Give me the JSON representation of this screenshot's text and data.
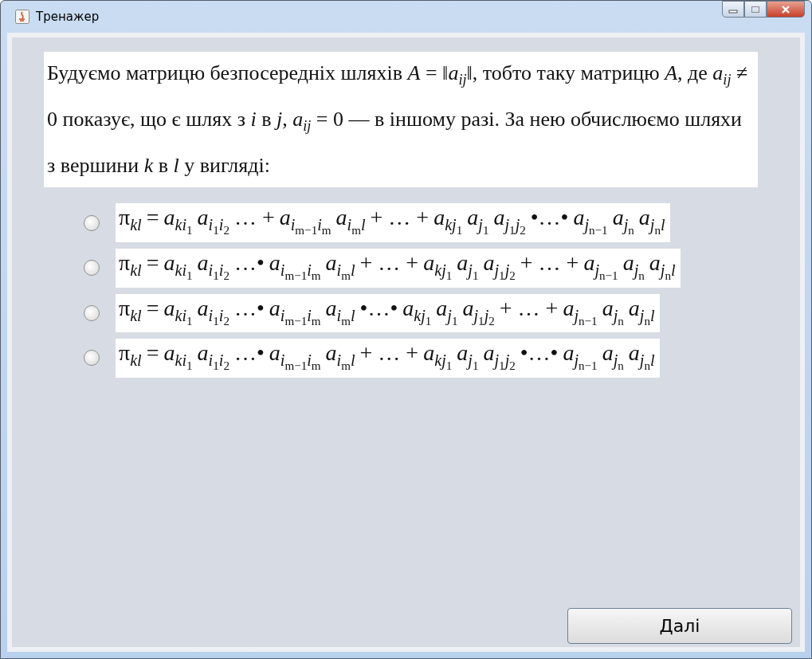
{
  "window": {
    "title": "Тренажер"
  },
  "intro": "Будуємо матрицю безпосередніх шляхів *A* = ‖*a*$_{ij}$‖, тобто таку матрицю *A*, де *a*$_{ij}$ ≠ 0 показує, що є шлях з *i* в *j*, *a*$_{ij}$ = 0 — в іншому разі. За нею обчислюємо шляхи з вершини *k* в *l* у вигляді:",
  "options": [
    {
      "selected": false,
      "formula": [
        {
          "kind": "pi",
          "base": "π",
          "sub": [
            [
              "kl"
            ]
          ]
        },
        {
          "kind": "op",
          "text": "="
        },
        {
          "kind": "var",
          "base": "a",
          "sub": [
            [
              "k"
            ],
            [
              "i",
              "1"
            ]
          ]
        },
        {
          "kind": "var",
          "base": "a",
          "sub": [
            [
              "i",
              "1"
            ],
            [
              "i",
              "2"
            ]
          ]
        },
        {
          "kind": "op",
          "text": "… +"
        },
        {
          "kind": "var",
          "base": "a",
          "sub": [
            [
              "i",
              "m−1"
            ],
            [
              "i",
              "m"
            ]
          ]
        },
        {
          "kind": "var",
          "base": "a",
          "sub": [
            [
              "i",
              "m"
            ],
            [
              "l"
            ]
          ]
        },
        {
          "kind": "op",
          "text": "+ … +"
        },
        {
          "kind": "var",
          "base": "a",
          "sub": [
            [
              "k"
            ],
            [
              "j",
              "1"
            ]
          ]
        },
        {
          "kind": "var",
          "base": "a",
          "sub": [
            [
              "j",
              "1"
            ]
          ]
        },
        {
          "kind": "var",
          "base": "a",
          "sub": [
            [
              "j",
              "1"
            ],
            [
              "j",
              "2"
            ]
          ]
        },
        {
          "kind": "op",
          "text": "•…•"
        },
        {
          "kind": "var",
          "base": "a",
          "sub": [
            [
              "j",
              "n−1"
            ]
          ]
        },
        {
          "kind": "var",
          "base": "a",
          "sub": [
            [
              "j",
              "n"
            ]
          ]
        },
        {
          "kind": "var",
          "base": "a",
          "sub": [
            [
              "j",
              "n"
            ],
            [
              "l"
            ]
          ]
        }
      ]
    },
    {
      "selected": false,
      "formula": [
        {
          "kind": "pi",
          "base": "π",
          "sub": [
            [
              "kl"
            ]
          ]
        },
        {
          "kind": "op",
          "text": "="
        },
        {
          "kind": "var",
          "base": "a",
          "sub": [
            [
              "k"
            ],
            [
              "i",
              "1"
            ]
          ]
        },
        {
          "kind": "var",
          "base": "a",
          "sub": [
            [
              "i",
              "1"
            ],
            [
              "i",
              "2"
            ]
          ]
        },
        {
          "kind": "op",
          "text": "…•"
        },
        {
          "kind": "var",
          "base": "a",
          "sub": [
            [
              "i",
              "m−1"
            ],
            [
              "i",
              "m"
            ]
          ]
        },
        {
          "kind": "var",
          "base": "a",
          "sub": [
            [
              "i",
              "m"
            ],
            [
              "l"
            ]
          ]
        },
        {
          "kind": "op",
          "text": "+ … +"
        },
        {
          "kind": "var",
          "base": "a",
          "sub": [
            [
              "k"
            ],
            [
              "j",
              "1"
            ]
          ]
        },
        {
          "kind": "var",
          "base": "a",
          "sub": [
            [
              "j",
              "1"
            ]
          ]
        },
        {
          "kind": "var",
          "base": "a",
          "sub": [
            [
              "j",
              "1"
            ],
            [
              "j",
              "2"
            ]
          ]
        },
        {
          "kind": "op",
          "text": "+ … +"
        },
        {
          "kind": "var",
          "base": "a",
          "sub": [
            [
              "j",
              "n−1"
            ]
          ]
        },
        {
          "kind": "var",
          "base": "a",
          "sub": [
            [
              "j",
              "n"
            ]
          ]
        },
        {
          "kind": "var",
          "base": "a",
          "sub": [
            [
              "j",
              "n"
            ],
            [
              "l"
            ]
          ]
        }
      ]
    },
    {
      "selected": false,
      "formula": [
        {
          "kind": "pi",
          "base": "π",
          "sub": [
            [
              "kl"
            ]
          ]
        },
        {
          "kind": "op",
          "text": "="
        },
        {
          "kind": "var",
          "base": "a",
          "sub": [
            [
              "k"
            ],
            [
              "i",
              "1"
            ]
          ]
        },
        {
          "kind": "var",
          "base": "a",
          "sub": [
            [
              "i",
              "1"
            ],
            [
              "i",
              "2"
            ]
          ]
        },
        {
          "kind": "op",
          "text": "…•"
        },
        {
          "kind": "var",
          "base": "a",
          "sub": [
            [
              "i",
              "m−1"
            ],
            [
              "i",
              "m"
            ]
          ]
        },
        {
          "kind": "var",
          "base": "a",
          "sub": [
            [
              "i",
              "m"
            ],
            [
              "l"
            ]
          ]
        },
        {
          "kind": "op",
          "text": "•…•"
        },
        {
          "kind": "var",
          "base": "a",
          "sub": [
            [
              "k"
            ],
            [
              "j",
              "1"
            ]
          ]
        },
        {
          "kind": "var",
          "base": "a",
          "sub": [
            [
              "j",
              "1"
            ]
          ]
        },
        {
          "kind": "var",
          "base": "a",
          "sub": [
            [
              "j",
              "1"
            ],
            [
              "j",
              "2"
            ]
          ]
        },
        {
          "kind": "op",
          "text": "+ … +"
        },
        {
          "kind": "var",
          "base": "a",
          "sub": [
            [
              "j",
              "n−1"
            ]
          ]
        },
        {
          "kind": "var",
          "base": "a",
          "sub": [
            [
              "j",
              "n"
            ]
          ]
        },
        {
          "kind": "var",
          "base": "a",
          "sub": [
            [
              "j",
              "n"
            ],
            [
              "l"
            ]
          ]
        }
      ]
    },
    {
      "selected": false,
      "formula": [
        {
          "kind": "pi",
          "base": "π",
          "sub": [
            [
              "kl"
            ]
          ]
        },
        {
          "kind": "op",
          "text": "="
        },
        {
          "kind": "var",
          "base": "a",
          "sub": [
            [
              "k"
            ],
            [
              "i",
              "1"
            ]
          ]
        },
        {
          "kind": "var",
          "base": "a",
          "sub": [
            [
              "i",
              "1"
            ],
            [
              "i",
              "2"
            ]
          ]
        },
        {
          "kind": "op",
          "text": "…•"
        },
        {
          "kind": "var",
          "base": "a",
          "sub": [
            [
              "i",
              "m−1"
            ],
            [
              "i",
              "m"
            ]
          ]
        },
        {
          "kind": "var",
          "base": "a",
          "sub": [
            [
              "i",
              "m"
            ],
            [
              "l"
            ]
          ]
        },
        {
          "kind": "op",
          "text": "+ … +"
        },
        {
          "kind": "var",
          "base": "a",
          "sub": [
            [
              "k"
            ],
            [
              "j",
              "1"
            ]
          ]
        },
        {
          "kind": "var",
          "base": "a",
          "sub": [
            [
              "j",
              "1"
            ]
          ]
        },
        {
          "kind": "var",
          "base": "a",
          "sub": [
            [
              "j",
              "1"
            ],
            [
              "j",
              "2"
            ]
          ]
        },
        {
          "kind": "op",
          "text": "•…•"
        },
        {
          "kind": "var",
          "base": "a",
          "sub": [
            [
              "j",
              "n−1"
            ]
          ]
        },
        {
          "kind": "var",
          "base": "a",
          "sub": [
            [
              "j",
              "n"
            ]
          ]
        },
        {
          "kind": "var",
          "base": "a",
          "sub": [
            [
              "j",
              "n"
            ],
            [
              "l"
            ]
          ]
        }
      ]
    }
  ],
  "next_button": "Далі"
}
